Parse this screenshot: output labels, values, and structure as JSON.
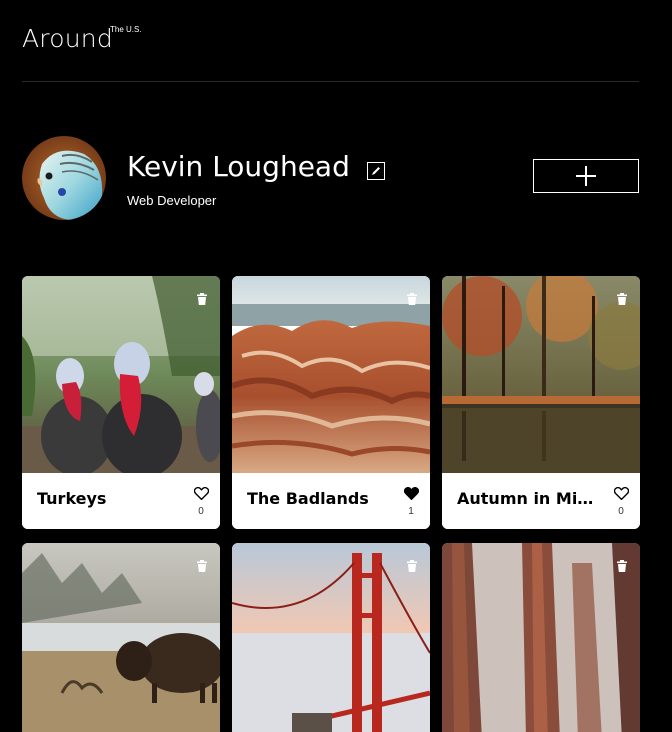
{
  "app": {
    "title": "Around",
    "subtitle": "The U.S."
  },
  "profile": {
    "name": "Kevin Loughead",
    "role": "Web Developer"
  },
  "cards": [
    {
      "title": "Turkeys",
      "likes": "0",
      "liked": false
    },
    {
      "title": "The Badlands",
      "likes": "1",
      "liked": true
    },
    {
      "title": "Autumn in Michigan",
      "likes": "0",
      "liked": false
    },
    {
      "title": "",
      "likes": "",
      "liked": false
    },
    {
      "title": "",
      "likes": "",
      "liked": false
    },
    {
      "title": "",
      "likes": "",
      "liked": false
    }
  ],
  "colors": {
    "background": "#000000",
    "text": "#ffffff",
    "card": "#ffffff",
    "card_text": "#000000"
  },
  "icons": {
    "edit": "pencil-icon",
    "add": "plus-icon",
    "delete": "trash-icon",
    "like": "heart-icon"
  }
}
